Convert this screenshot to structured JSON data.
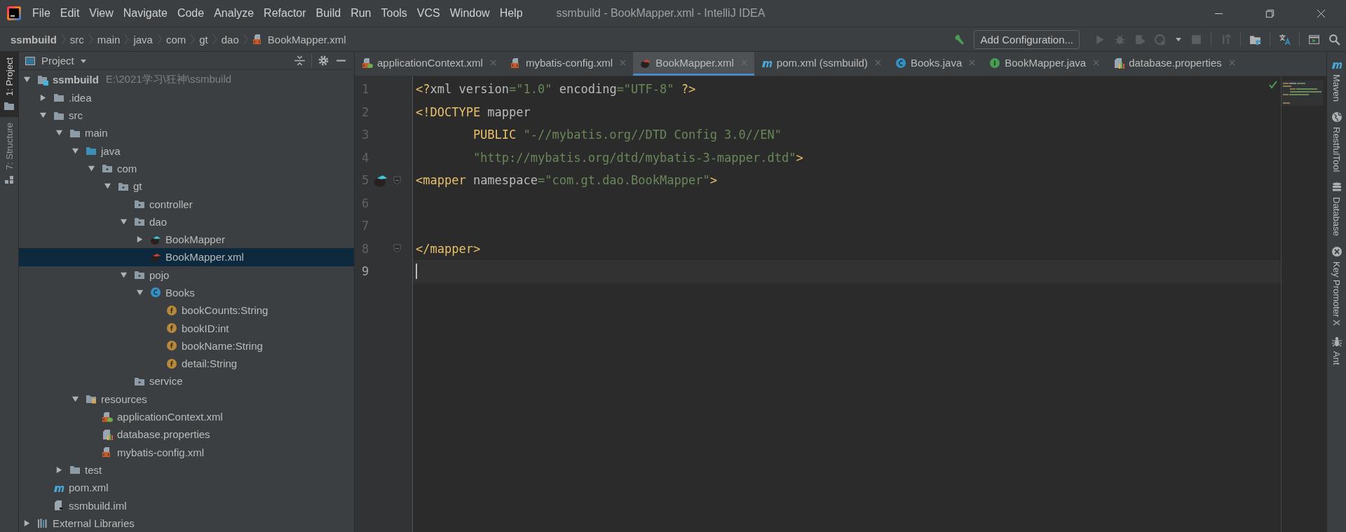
{
  "window": {
    "title": "ssmbuild - BookMapper.xml - IntelliJ IDEA"
  },
  "menu": [
    "File",
    "Edit",
    "View",
    "Navigate",
    "Code",
    "Analyze",
    "Refactor",
    "Build",
    "Run",
    "Tools",
    "VCS",
    "Window",
    "Help"
  ],
  "breadcrumbs": [
    {
      "label": "ssmbuild",
      "kind": "project"
    },
    {
      "label": "src",
      "kind": "folder"
    },
    {
      "label": "main",
      "kind": "folder"
    },
    {
      "label": "java",
      "kind": "folder"
    },
    {
      "label": "com",
      "kind": "folder"
    },
    {
      "label": "gt",
      "kind": "folder"
    },
    {
      "label": "dao",
      "kind": "folder"
    },
    {
      "label": "BookMapper.xml",
      "kind": "file"
    }
  ],
  "toolbar": {
    "run_config": "Add Configuration..."
  },
  "left_tool_windows": [
    {
      "label": "1: Project",
      "selected": true,
      "kind": "folder"
    },
    {
      "label": "7: Structure",
      "selected": false,
      "kind": "structure"
    }
  ],
  "project_panel": {
    "title": "Project"
  },
  "tree": [
    {
      "label": "ssmbuild",
      "path": "E:\\2021学习\\狂神\\ssmbuild",
      "kind": "module",
      "expanded": true,
      "selected": false,
      "children": [
        {
          "label": ".idea",
          "kind": "folder",
          "expanded": false,
          "selected": false
        },
        {
          "label": "src",
          "kind": "folder",
          "expanded": true,
          "selected": false,
          "children": [
            {
              "label": "main",
              "kind": "folder",
              "expanded": true,
              "selected": false,
              "children": [
                {
                  "label": "java",
                  "kind": "source",
                  "expanded": true,
                  "selected": false,
                  "children": [
                    {
                      "label": "com",
                      "kind": "package",
                      "expanded": true,
                      "selected": false,
                      "children": [
                        {
                          "label": "gt",
                          "kind": "package",
                          "expanded": true,
                          "selected": false,
                          "children": [
                            {
                              "label": "controller",
                              "kind": "package",
                              "selected": false
                            },
                            {
                              "label": "dao",
                              "kind": "package",
                              "expanded": true,
                              "selected": false,
                              "children": [
                                {
                                  "label": "BookMapper",
                                  "kind": "mapper",
                                  "expanded": false,
                                  "selected": false
                                },
                                {
                                  "label": "BookMapper.xml",
                                  "kind": "mapperxml",
                                  "selected": true
                                }
                              ]
                            },
                            {
                              "label": "pojo",
                              "kind": "package",
                              "expanded": true,
                              "selected": false,
                              "children": [
                                {
                                  "label": "Books",
                                  "kind": "class",
                                  "expanded": true,
                                  "selected": false,
                                  "children": [
                                    {
                                      "label": "bookCounts:String",
                                      "kind": "field",
                                      "selected": false
                                    },
                                    {
                                      "label": "bookID:int",
                                      "kind": "field",
                                      "selected": false
                                    },
                                    {
                                      "label": "bookName:String",
                                      "kind": "field",
                                      "selected": false
                                    },
                                    {
                                      "label": "detail:String",
                                      "kind": "field",
                                      "selected": false
                                    }
                                  ]
                                }
                              ]
                            },
                            {
                              "label": "service",
                              "kind": "package",
                              "selected": false
                            }
                          ]
                        }
                      ]
                    }
                  ]
                },
                {
                  "label": "resources",
                  "kind": "resources",
                  "expanded": true,
                  "selected": false,
                  "children": [
                    {
                      "label": "applicationContext.xml",
                      "kind": "spring",
                      "selected": false
                    },
                    {
                      "label": "database.properties",
                      "kind": "properties",
                      "selected": false
                    },
                    {
                      "label": "mybatis-config.xml",
                      "kind": "xml",
                      "selected": false
                    }
                  ]
                }
              ]
            },
            {
              "label": "test",
              "kind": "folder",
              "expanded": false,
              "selected": false
            }
          ]
        },
        {
          "label": "pom.xml",
          "kind": "maven",
          "selected": false
        },
        {
          "label": "ssmbuild.iml",
          "kind": "iml",
          "selected": false
        }
      ]
    },
    {
      "label": "External Libraries",
      "kind": "libraries",
      "expanded": false,
      "selected": false
    }
  ],
  "tabs": [
    {
      "label": "applicationContext.xml",
      "kind": "spring",
      "selected": false
    },
    {
      "label": "mybatis-config.xml",
      "kind": "xml",
      "selected": false
    },
    {
      "label": "BookMapper.xml",
      "kind": "mapperxml",
      "selected": true
    },
    {
      "label": "pom.xml (ssmbuild)",
      "kind": "maven",
      "selected": false
    },
    {
      "label": "Books.java",
      "kind": "class",
      "selected": false
    },
    {
      "label": "BookMapper.java",
      "kind": "interface",
      "selected": false
    },
    {
      "label": "database.properties",
      "kind": "properties",
      "selected": false
    }
  ],
  "editor": {
    "lines": [
      {
        "number": "1",
        "marker": false,
        "fold": false,
        "current": false,
        "tokens": [
          {
            "text": "<?",
            "kind": "tag"
          },
          {
            "text": "xml version",
            "kind": "plain"
          },
          {
            "text": "=\"1.0\"",
            "kind": "value"
          },
          {
            "text": " encoding",
            "kind": "plain"
          },
          {
            "text": "=\"UTF-8\"",
            "kind": "value"
          },
          {
            "text": " ?>",
            "kind": "tag"
          }
        ]
      },
      {
        "number": "2",
        "marker": false,
        "fold": false,
        "current": false,
        "tokens": [
          {
            "text": "<!DOCTYPE",
            "kind": "tag"
          },
          {
            "text": " mapper",
            "kind": "plain"
          }
        ]
      },
      {
        "number": "3",
        "marker": false,
        "fold": false,
        "current": false,
        "tokens": [
          {
            "text": "        PUBLIC",
            "kind": "tag"
          },
          {
            "text": " \"-//mybatis.org//DTD Config 3.0//EN\"",
            "kind": "value"
          }
        ]
      },
      {
        "number": "4",
        "marker": false,
        "fold": false,
        "current": false,
        "tokens": [
          {
            "text": "        \"http://mybatis.org/dtd/mybatis-3-mapper.dtd\"",
            "kind": "value"
          },
          {
            "text": ">",
            "kind": "tag"
          }
        ]
      },
      {
        "number": "5",
        "marker": true,
        "fold": true,
        "current": false,
        "tokens": [
          {
            "text": "<mapper",
            "kind": "tag"
          },
          {
            "text": " namespace",
            "kind": "plain"
          },
          {
            "text": "=\"com.gt.dao.BookMapper\"",
            "kind": "value"
          },
          {
            "text": ">",
            "kind": "tag"
          }
        ]
      },
      {
        "number": "6",
        "marker": false,
        "fold": false,
        "current": false
      },
      {
        "number": "7",
        "marker": false,
        "fold": false,
        "current": false
      },
      {
        "number": "8",
        "marker": false,
        "fold": true,
        "current": false,
        "tokens": [
          {
            "text": "</mapper>",
            "kind": "tag"
          }
        ]
      },
      {
        "number": "9",
        "marker": false,
        "fold": false,
        "current": true
      }
    ]
  },
  "right_tool_windows": [
    {
      "label": "Maven",
      "kind": "maven"
    },
    {
      "label": "RestfulTool",
      "kind": "globe"
    },
    {
      "label": "Database",
      "kind": "database"
    },
    {
      "label": "Key Promoter X",
      "kind": "keypromoter"
    },
    {
      "label": "Ant",
      "kind": "ant"
    }
  ]
}
